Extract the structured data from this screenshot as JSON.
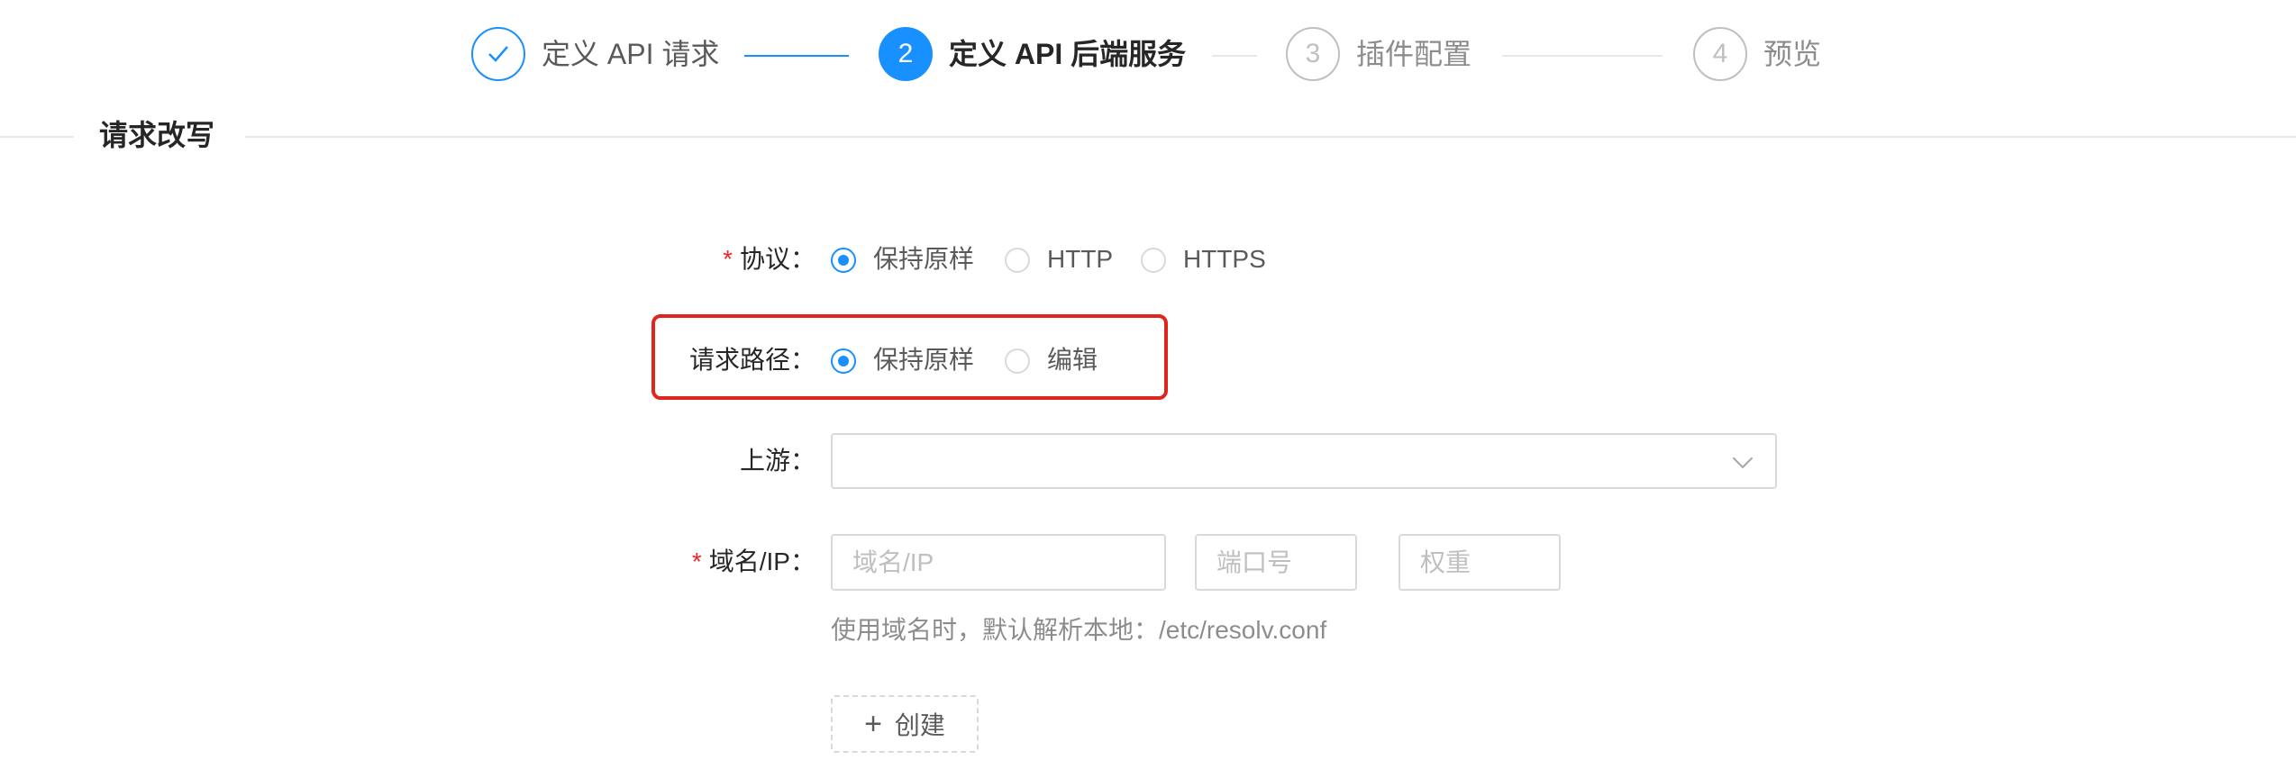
{
  "steps": [
    {
      "number": "1",
      "title": "定义 API 请求",
      "status": "finish"
    },
    {
      "number": "2",
      "title": "定义 API 后端服务",
      "status": "process"
    },
    {
      "number": "3",
      "title": "插件配置",
      "status": "wait"
    },
    {
      "number": "4",
      "title": "预览",
      "status": "wait"
    }
  ],
  "section": {
    "title": "请求改写"
  },
  "form": {
    "protocol": {
      "label": "协议",
      "required": true,
      "options": [
        "保持原样",
        "HTTP",
        "HTTPS"
      ],
      "selected": "保持原样"
    },
    "request_path": {
      "label": "请求路径",
      "options": [
        "保持原样",
        "编辑"
      ],
      "selected": "保持原样"
    },
    "upstream": {
      "label": "上游",
      "value": ""
    },
    "host": {
      "label": "域名/IP",
      "required": true,
      "placeholders": {
        "host": "域名/IP",
        "port": "端口号",
        "weight": "权重"
      },
      "help": "使用域名时，默认解析本地：/etc/resolv.conf"
    },
    "create_button": "创建"
  },
  "colors": {
    "primary": "#1890ff",
    "required": "#f5222d",
    "highlight": "#e0261c"
  },
  "icons": {
    "step1": "check-icon",
    "select": "chevron-down-icon",
    "create": "plus-icon"
  }
}
